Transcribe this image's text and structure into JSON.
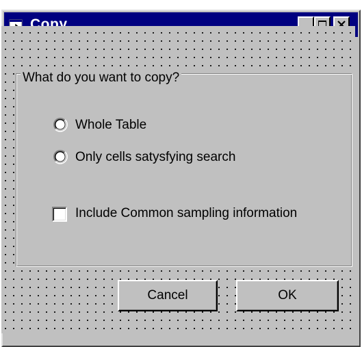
{
  "window": {
    "title": "Copy",
    "app_icon": "form-icon",
    "title_buttons": [
      "minimize-icon",
      "maximize-icon",
      "close-icon"
    ]
  },
  "frame": {
    "caption": "What do you want to copy?"
  },
  "options": [
    {
      "label": "Whole Table",
      "selected": false
    },
    {
      "label": "Only cells satysfying search",
      "selected": false
    }
  ],
  "checkbox": {
    "label": "Include Common sampling information",
    "checked": false
  },
  "buttons": {
    "cancel": "Cancel",
    "ok": "OK"
  },
  "colors": {
    "titlebar": "#000080",
    "face": "#c0c0c0"
  }
}
